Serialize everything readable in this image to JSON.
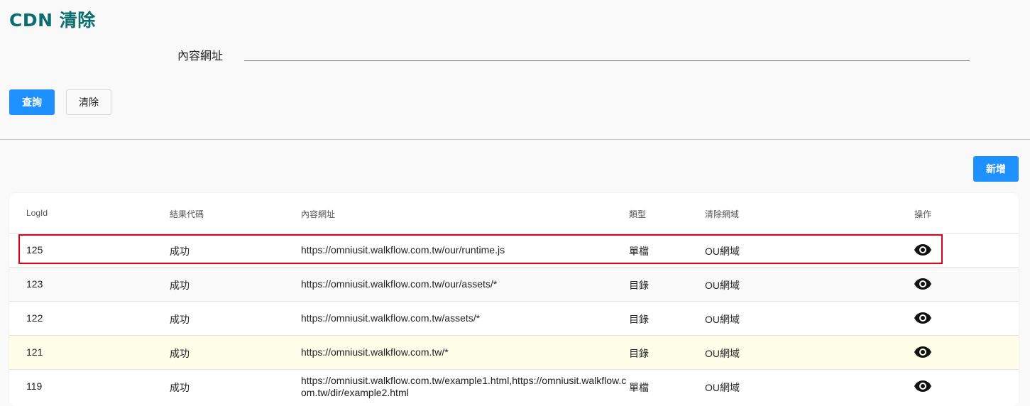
{
  "page": {
    "title": "CDN 清除"
  },
  "search": {
    "label": "內容網址",
    "value": "",
    "placeholder": ""
  },
  "buttons": {
    "query": "查詢",
    "clear": "清除",
    "add": "新增"
  },
  "colors": {
    "title": "#0b6e6e",
    "primary": "#1e90ff",
    "highlight_border": "#e0001a",
    "row_highlight": "#fdfde8"
  },
  "table": {
    "headers": [
      "LogId",
      "結果代碼",
      "內容網址",
      "類型",
      "清除網域",
      "操作"
    ],
    "rows": [
      {
        "log_id": "125",
        "result": "成功",
        "url": "https://omniusit.walkflow.com.tw/our/runtime.js",
        "type": "單檔",
        "domain": "OU網域",
        "action_icon": "eye-icon"
      },
      {
        "log_id": "123",
        "result": "成功",
        "url": "https://omniusit.walkflow.com.tw/our/assets/*",
        "type": "目錄",
        "domain": "OU網域",
        "action_icon": "eye-icon"
      },
      {
        "log_id": "122",
        "result": "成功",
        "url": "https://omniusit.walkflow.com.tw/assets/*",
        "type": "目錄",
        "domain": "OU網域",
        "action_icon": "eye-icon"
      },
      {
        "log_id": "121",
        "result": "成功",
        "url": "https://omniusit.walkflow.com.tw/*",
        "type": "目錄",
        "domain": "OU網域",
        "action_icon": "eye-icon"
      },
      {
        "log_id": "119",
        "result": "成功",
        "url": "https://omniusit.walkflow.com.tw/example1.html,https://omniusit.walkflow.com.tw/dir/example2.html",
        "type": "單檔",
        "domain": "OU網域",
        "action_icon": "eye-icon"
      }
    ]
  }
}
